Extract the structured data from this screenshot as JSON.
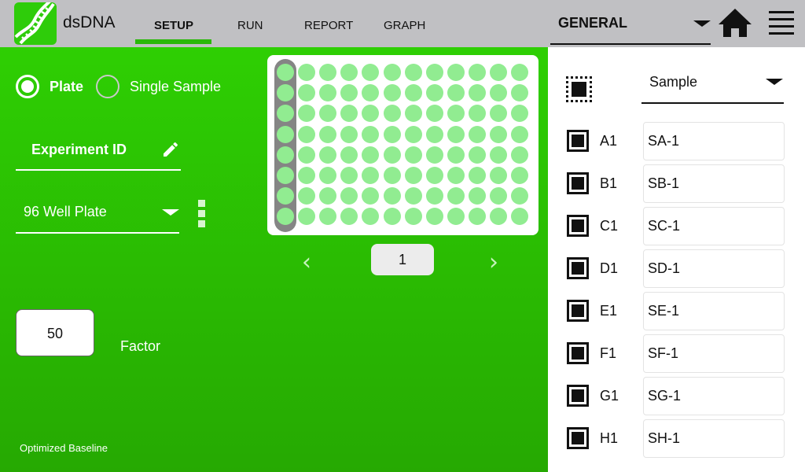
{
  "header": {
    "app_title": "dsDNA",
    "tabs": [
      {
        "label": "SETUP",
        "active": true
      },
      {
        "label": "RUN",
        "active": false
      },
      {
        "label": "REPORT",
        "active": false
      },
      {
        "label": "GRAPH",
        "active": false
      }
    ],
    "mode_select": "GENERAL",
    "icons": [
      "dna-logo",
      "home-icon",
      "menu-icon"
    ]
  },
  "setup": {
    "mode_options": [
      {
        "label": "Plate",
        "selected": true
      },
      {
        "label": "Single Sample",
        "selected": false
      }
    ],
    "experiment_id_label": "Experiment ID",
    "plate_type": "96 Well Plate",
    "plate": {
      "rows": [
        "A",
        "B",
        "C",
        "D",
        "E",
        "F",
        "G",
        "H"
      ],
      "columns": 12,
      "selected_column": 1
    },
    "page_number": "1",
    "factor_value": "50",
    "factor_label": "Factor",
    "baseline_label": "Optimized Baseline"
  },
  "samples": {
    "column_select": "Sample",
    "rows": [
      {
        "well": "A1",
        "name": "SA-1",
        "checked": true
      },
      {
        "well": "B1",
        "name": "SB-1",
        "checked": true
      },
      {
        "well": "C1",
        "name": "SC-1",
        "checked": true
      },
      {
        "well": "D1",
        "name": "SD-1",
        "checked": true
      },
      {
        "well": "E1",
        "name": "SE-1",
        "checked": true
      },
      {
        "well": "F1",
        "name": "SF-1",
        "checked": true
      },
      {
        "well": "G1",
        "name": "SG-1",
        "checked": true
      },
      {
        "well": "H1",
        "name": "SH-1",
        "checked": true
      }
    ]
  },
  "colors": {
    "brand_green": "#2ecf03",
    "header_gray": "#c0c0c3",
    "well_green": "#91ec91",
    "highlight_gray": "#858585"
  }
}
